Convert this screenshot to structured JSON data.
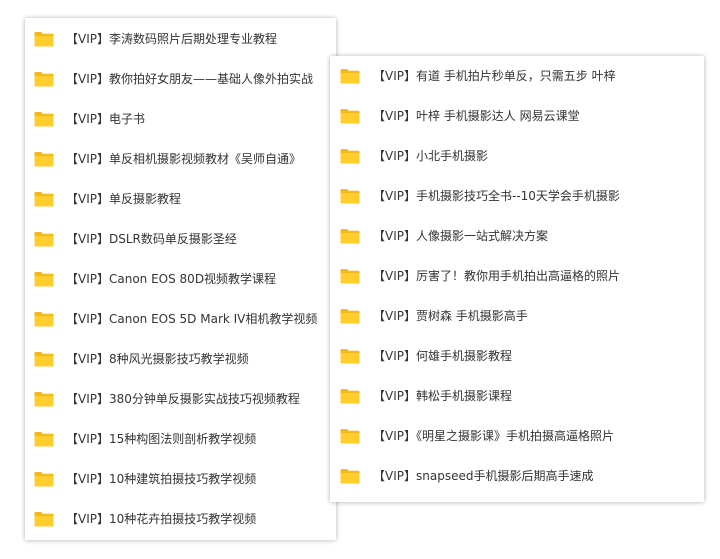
{
  "colors": {
    "folder_back": "#F4B81C",
    "folder_front": "#FFCD2E",
    "text": "#333333"
  },
  "icon": "folder-icon",
  "left_panel": {
    "items": [
      {
        "label": "【VIP】李涛数码照片后期处理专业教程"
      },
      {
        "label": "【VIP】教你拍好女朋友——基础人像外拍实战"
      },
      {
        "label": "【VIP】电子书"
      },
      {
        "label": "【VIP】单反相机摄影视频教材《吴师自通》"
      },
      {
        "label": "【VIP】单反摄影教程"
      },
      {
        "label": "【VIP】DSLR数码单反摄影圣经"
      },
      {
        "label": "【VIP】Canon EOS 80D视频教学课程"
      },
      {
        "label": "【VIP】Canon EOS 5D Mark IV相机教学视频"
      },
      {
        "label": "【VIP】8种风光摄影技巧教学视频"
      },
      {
        "label": "【VIP】380分钟单反摄影实战技巧视频教程"
      },
      {
        "label": "【VIP】15种构图法则剖析教学视频"
      },
      {
        "label": "【VIP】10种建筑拍摄技巧教学视频"
      },
      {
        "label": "【VIP】10种花卉拍摄技巧教学视频"
      }
    ]
  },
  "right_panel": {
    "items": [
      {
        "label": "【VIP】有道 手机拍片秒单反，只需五步  叶梓"
      },
      {
        "label": "【VIP】叶梓 手机摄影达人 网易云课堂"
      },
      {
        "label": "【VIP】小北手机摄影"
      },
      {
        "label": "【VIP】手机摄影技巧全书--10天学会手机摄影"
      },
      {
        "label": "【VIP】人像摄影一站式解决方案"
      },
      {
        "label": "【VIP】厉害了！教你用手机拍出高逼格的照片"
      },
      {
        "label": "【VIP】贾树森 手机摄影高手"
      },
      {
        "label": "【VIP】何雄手机摄影教程"
      },
      {
        "label": "【VIP】韩松手机摄影课程"
      },
      {
        "label": "【VIP】《明星之摄影课》手机拍摄高逼格照片"
      },
      {
        "label": "【VIP】snapseed手机摄影后期高手速成"
      }
    ]
  }
}
